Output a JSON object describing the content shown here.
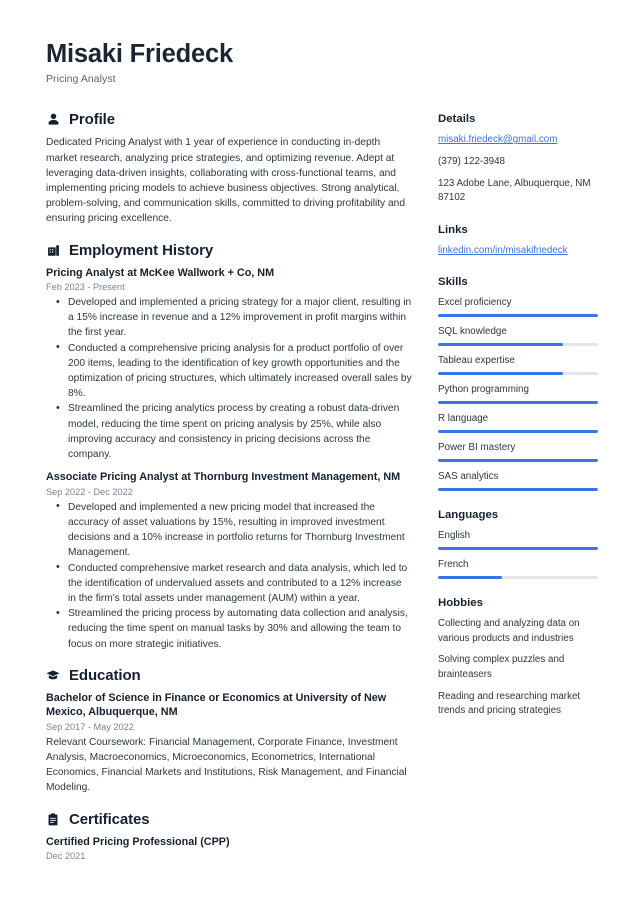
{
  "header": {
    "full_name": "Misaki Friedeck",
    "job_title": "Pricing Analyst"
  },
  "theme": {
    "accent": "#3a74ea",
    "heading": "#16202e",
    "body_text": "#2c3744",
    "muted": "#7b8594",
    "bar_track": "#e3e6ea"
  },
  "sections": {
    "profile": {
      "icon": "person-icon",
      "title": "Profile",
      "text": "Dedicated Pricing Analyst with 1 year of experience in conducting in-depth market research, analyzing price strategies, and optimizing revenue. Adept at leveraging data-driven insights, collaborating with cross-functional teams, and implementing pricing models to achieve business objectives. Strong analytical, problem-solving, and communication skills, committed to driving profitability and ensuring pricing excellence."
    },
    "employment": {
      "icon": "briefcase-icon",
      "title": "Employment History",
      "entries": [
        {
          "title": "Pricing Analyst at McKee Wallwork + Co, NM",
          "date": "Feb 2023 - Present",
          "bullets": [
            "Developed and implemented a pricing strategy for a major client, resulting in a 15% increase in revenue and a 12% improvement in profit margins within the first year.",
            "Conducted a comprehensive pricing analysis for a product portfolio of over 200 items, leading to the identification of key growth opportunities and the optimization of pricing structures, which ultimately increased overall sales by 8%.",
            "Streamlined the pricing analytics process by creating a robust data-driven model, reducing the time spent on pricing analysis by 25%, while also improving accuracy and consistency in pricing decisions across the company."
          ]
        },
        {
          "title": "Associate Pricing Analyst at Thornburg Investment Management, NM",
          "date": "Sep 2022 - Dec 2022",
          "bullets": [
            "Developed and implemented a new pricing model that increased the accuracy of asset valuations by 15%, resulting in improved investment decisions and a 10% increase in portfolio returns for Thornburg Investment Management.",
            "Conducted comprehensive market research and data analysis, which led to the identification of undervalued assets and contributed to a 12% increase in the firm's total assets under management (AUM) within a year.",
            "Streamlined the pricing process by automating data collection and analysis, reducing the time spent on manual tasks by 30% and allowing the team to focus on more strategic initiatives."
          ]
        }
      ]
    },
    "education": {
      "icon": "graduation-cap-icon",
      "title": "Education",
      "entries": [
        {
          "title": "Bachelor of Science in Finance or Economics at University of New Mexico, Albuquerque, NM",
          "date": "Sep 2017 - May 2022",
          "body": "Relevant Coursework: Financial Management, Corporate Finance, Investment Analysis, Macroeconomics, Microeconomics, Econometrics, International Economics, Financial Markets and Institutions, Risk Management, and Financial Modeling."
        }
      ]
    },
    "certificates": {
      "icon": "certificate-icon",
      "title": "Certificates",
      "entries": [
        {
          "title": "Certified Pricing Professional (CPP)",
          "date": "Dec 2021"
        }
      ]
    }
  },
  "sidebar": {
    "details": {
      "title": "Details",
      "email": "misaki.friedeck@gmail.com",
      "phone": "(379) 122-3948",
      "address": "123 Adobe Lane, Albuquerque, NM 87102"
    },
    "links": {
      "title": "Links",
      "items": [
        {
          "label": "linkedin.com/in/misakifriedeck"
        }
      ]
    },
    "skills": {
      "title": "Skills",
      "items": [
        {
          "label": "Excel proficiency",
          "level": 100
        },
        {
          "label": "SQL knowledge",
          "level": 78
        },
        {
          "label": "Tableau expertise",
          "level": 78
        },
        {
          "label": "Python programming",
          "level": 100
        },
        {
          "label": "R language",
          "level": 100
        },
        {
          "label": "Power BI mastery",
          "level": 100
        },
        {
          "label": "SAS analytics",
          "level": 100
        }
      ]
    },
    "languages": {
      "title": "Languages",
      "items": [
        {
          "label": "English",
          "level": 100
        },
        {
          "label": "French",
          "level": 40
        }
      ]
    },
    "hobbies": {
      "title": "Hobbies",
      "items": [
        {
          "label": "Collecting and analyzing data on various products and industries"
        },
        {
          "label": "Solving complex puzzles and brainteasers"
        },
        {
          "label": "Reading and researching market trends and pricing strategies"
        }
      ]
    }
  }
}
